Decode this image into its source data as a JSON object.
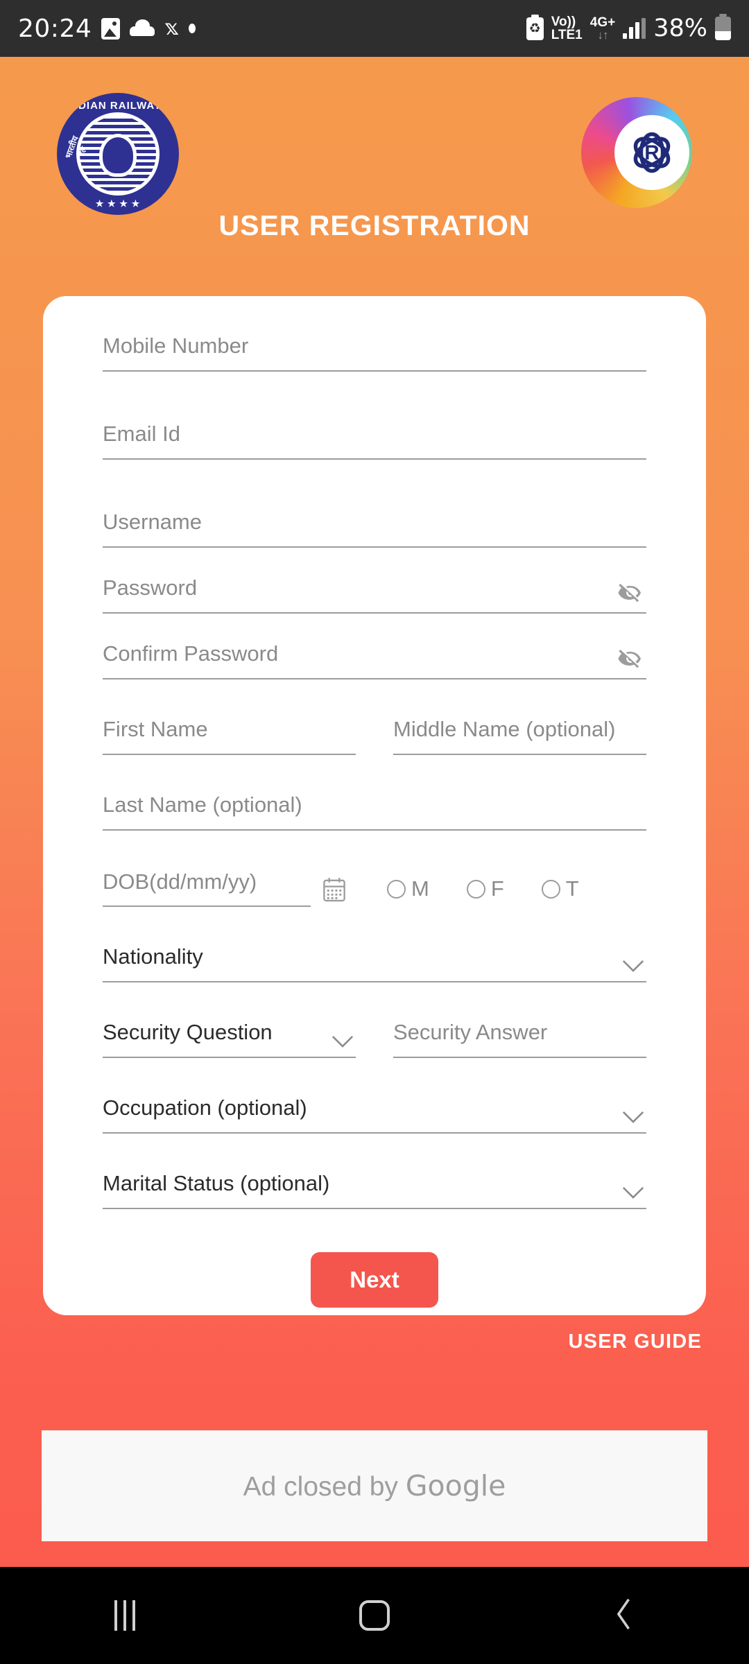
{
  "status_bar": {
    "time": "20:24",
    "left_icons": [
      "image-icon",
      "cloud-icon",
      "x-icon",
      "dot-icon"
    ],
    "battery_saver": "battery-saver-icon",
    "volte_line1": "Vo))",
    "volte_line2": "LTE1",
    "network": "4G+",
    "data_arrows": "↓↑",
    "signal": "signal-bars-icon",
    "battery_percent": "38%"
  },
  "header": {
    "railways_logo": {
      "name": "indian-railways-logo",
      "text_top": "INDIAN RAILWAYS",
      "text_left": "भारतीय रेल"
    },
    "irctc_logo": {
      "name": "irctc-logo"
    },
    "title": "USER REGISTRATION"
  },
  "form": {
    "mobile_number": {
      "placeholder": "Mobile Number",
      "value": ""
    },
    "email_id": {
      "placeholder": "Email Id",
      "value": ""
    },
    "username": {
      "placeholder": "Username",
      "value": ""
    },
    "password": {
      "placeholder": "Password",
      "value": "",
      "toggle_icon": "eye-off-icon"
    },
    "confirm_password": {
      "placeholder": "Confirm Password",
      "value": "",
      "toggle_icon": "eye-off-icon"
    },
    "first_name": {
      "placeholder": "First Name",
      "value": ""
    },
    "middle_name": {
      "placeholder": "Middle Name (optional)",
      "value": ""
    },
    "last_name": {
      "placeholder": "Last Name (optional)",
      "value": ""
    },
    "dob": {
      "placeholder": "DOB(dd/mm/yy)",
      "value": "",
      "calendar_icon": "calendar-icon"
    },
    "gender": {
      "options": [
        {
          "code": "M",
          "label": "M",
          "selected": false
        },
        {
          "code": "F",
          "label": "F",
          "selected": false
        },
        {
          "code": "T",
          "label": "T",
          "selected": false
        }
      ]
    },
    "nationality": {
      "label": "Nationality",
      "selected_value": "Nationality",
      "chevron": "chevron-down-icon"
    },
    "security_question": {
      "label": "Security Question",
      "selected_value": "Security Question",
      "chevron": "chevron-down-icon"
    },
    "security_answer": {
      "placeholder": "Security Answer",
      "value": ""
    },
    "occupation": {
      "label": "Occupation (optional)",
      "selected_value": "Occupation (optional)",
      "chevron": "chevron-down-icon"
    },
    "marital_status": {
      "label": "Marital Status (optional)",
      "selected_value": "Marital Status (optional)",
      "chevron": "chevron-down-icon"
    },
    "next_button": "Next"
  },
  "user_guide": "USER GUIDE",
  "ad": {
    "text_prefix": "Ad closed by ",
    "brand": "Google"
  },
  "nav_bar": {
    "recents": "recents-icon",
    "home": "home-icon",
    "back": "back-icon"
  },
  "colors": {
    "background_top": "#F59B4B",
    "background_bottom": "#FB5A4E",
    "card": "#FFFFFF",
    "next_button": "#F4564D",
    "status_bar": "#2E2E2E",
    "nav_bar": "#000000",
    "placeholder_text": "#8A8A8A",
    "selected_text": "#2B2B2B",
    "field_underline": "#9C9C9C"
  }
}
